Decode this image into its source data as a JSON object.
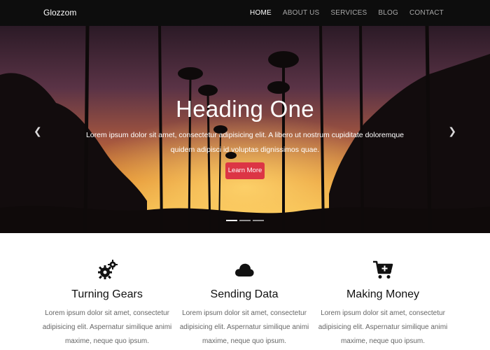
{
  "navbar": {
    "brand": "Glozzom",
    "links": [
      {
        "label": "HOME",
        "active": true
      },
      {
        "label": "ABOUT US",
        "active": false
      },
      {
        "label": "SERVICES",
        "active": false
      },
      {
        "label": "BLOG",
        "active": false
      },
      {
        "label": "CONTACT",
        "active": false
      }
    ]
  },
  "hero": {
    "title": "Heading One",
    "text": "Lorem ipsum dolor sit amet, consectetur adipisicing elit. A libero ut nostrum cupiditate doloremque quidem adipisci id voluptas dignissimos quae.",
    "button_label": "Learn More",
    "prev_icon": "chevron-left-icon",
    "next_icon": "chevron-right-icon",
    "slides_count": 3,
    "active_slide": 1
  },
  "features": [
    {
      "icon": "gears-icon",
      "title": "Turning Gears",
      "text": "Lorem ipsum dolor sit amet, consectetur adipisicing elit. Aspernatur similique animi maxime, neque quo ipsum."
    },
    {
      "icon": "cloud-icon",
      "title": "Sending Data",
      "text": "Lorem ipsum dolor sit amet, consectetur adipisicing elit. Aspernatur similique animi maxime, neque quo ipsum."
    },
    {
      "icon": "cart-plus-icon",
      "title": "Making Money",
      "text": "Lorem ipsum dolor sit amet, consectetur adipisicing elit. Aspernatur similique animi maxime, neque quo ipsum."
    }
  ],
  "colors": {
    "navbar_bg": "#0d0d0d",
    "button_red": "#dc3545"
  }
}
